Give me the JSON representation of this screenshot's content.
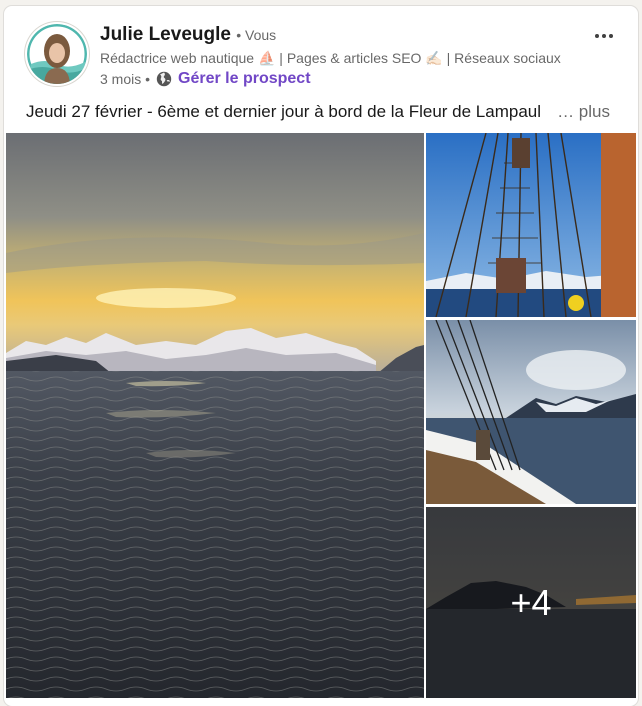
{
  "post": {
    "author_name": "Julie Leveugle",
    "degree": "• Vous",
    "headline": "Rédactrice web nautique ⛵ | Pages & articles SEO ✍🏻 | Réseaux sociaux",
    "time": "3 mois •",
    "manage_label": "Gérer le prospect",
    "text": "Jeudi 27 février - 6ème et dernier jour à bord de la Fleur de Lampaul",
    "see_more": "… plus",
    "extra_photos": "+4"
  },
  "icons": {
    "more": "ellipsis-icon",
    "visibility": "globe-icon"
  },
  "colors": {
    "accent": "#7147c6",
    "card_background": "#ffffff",
    "page_background": "#f4f2ee"
  }
}
